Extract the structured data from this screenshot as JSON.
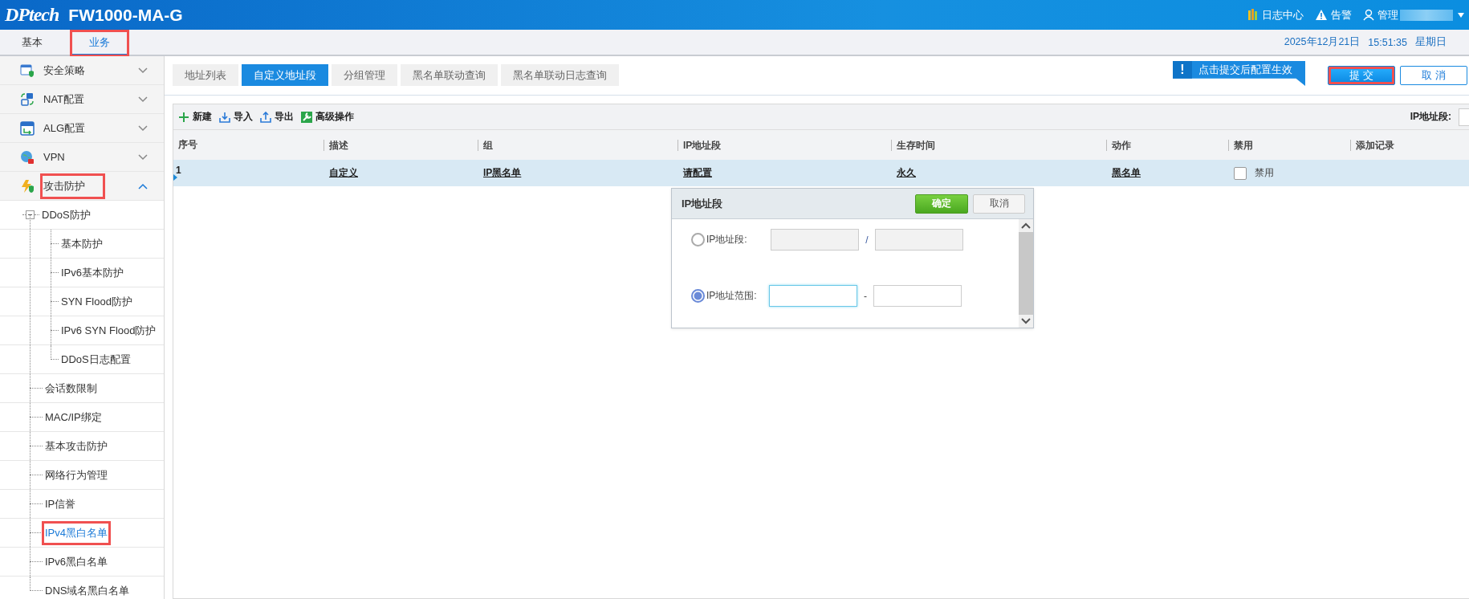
{
  "header": {
    "logo": "DPtech",
    "title": "FW1000-MA-G",
    "links": [
      {
        "label": "日志中心",
        "kind": "log"
      },
      {
        "label": "告警",
        "kind": "alarm"
      },
      {
        "label": "管理",
        "kind": "user"
      }
    ]
  },
  "nav_tabs": [
    {
      "label": "基本",
      "selected": false,
      "annotated": false
    },
    {
      "label": "业务",
      "selected": true,
      "annotated": true
    }
  ],
  "datetime": {
    "date": "2025年12月21日",
    "time": "15:51:35",
    "weekday": "星期日"
  },
  "sidebar": {
    "items": [
      {
        "label": "安全策略",
        "expanded": false,
        "selected": false,
        "annotated": false
      },
      {
        "label": "NAT配置",
        "expanded": false,
        "selected": false,
        "annotated": false
      },
      {
        "label": "ALG配置",
        "expanded": false,
        "selected": false,
        "annotated": false
      },
      {
        "label": "VPN",
        "expanded": false,
        "selected": false,
        "annotated": false
      },
      {
        "label": "攻击防护",
        "expanded": true,
        "selected": false,
        "annotated": true,
        "children": [
          {
            "label": "DDoS防护",
            "expanded": true,
            "selected": false,
            "annotated": false,
            "children": [
              {
                "label": "基本防护",
                "selected": false,
                "annotated": false
              },
              {
                "label": "IPv6基本防护",
                "selected": false,
                "annotated": false
              },
              {
                "label": "SYN Flood防护",
                "selected": false,
                "annotated": false
              },
              {
                "label": "IPv6 SYN Flood防护",
                "selected": false,
                "annotated": false
              },
              {
                "label": "DDoS日志配置",
                "selected": false,
                "annotated": false
              }
            ]
          },
          {
            "label": "会话数限制",
            "selected": false,
            "annotated": false
          },
          {
            "label": "MAC/IP绑定",
            "selected": false,
            "annotated": false
          },
          {
            "label": "基本攻击防护",
            "selected": false,
            "annotated": false
          },
          {
            "label": "网络行为管理",
            "selected": false,
            "annotated": false
          },
          {
            "label": "IP信誉",
            "selected": false,
            "annotated": false
          },
          {
            "label": "IPv4黑白名单",
            "selected": true,
            "annotated": true
          },
          {
            "label": "IPv6黑白名单",
            "selected": false,
            "annotated": false
          },
          {
            "label": "DNS域名黑白名单",
            "selected": false,
            "annotated": false
          }
        ]
      }
    ]
  },
  "tabs": [
    {
      "label": "地址列表",
      "selected": false
    },
    {
      "label": "自定义地址段",
      "selected": true
    },
    {
      "label": "分组管理",
      "selected": false
    },
    {
      "label": "黑名单联动查询",
      "selected": false
    },
    {
      "label": "黑名单联动日志查询",
      "selected": false
    }
  ],
  "notice": {
    "icon": "!",
    "text": "点击提交后配置生效"
  },
  "actions": [
    {
      "label": "提 交",
      "kind": "primary",
      "annotated": true
    },
    {
      "label": "取 消",
      "kind": "secondary",
      "annotated": false
    }
  ],
  "toolbar": [
    {
      "label": "新建",
      "kind": "add"
    },
    {
      "label": "导入",
      "kind": "import"
    },
    {
      "label": "导出",
      "kind": "export"
    },
    {
      "label": "高级操作",
      "kind": "advanced"
    }
  ],
  "filter": {
    "label": "IP地址段:"
  },
  "table": {
    "columns": [
      "序号",
      "描述",
      "组",
      "IP地址段",
      "生存时间",
      "动作",
      "禁用",
      "添加记录"
    ],
    "rows": [
      {
        "selected": true,
        "cells": [
          "1",
          "自定义",
          "IP黑名单",
          "请配置",
          "永久",
          "黑名单"
        ],
        "disable": {
          "label": "禁用",
          "checked": false
        }
      }
    ]
  },
  "dialog": {
    "title": "IP地址段",
    "confirm": "确定",
    "cancel": "取消",
    "options": [
      {
        "label": "IP地址段:",
        "selected": false,
        "separator": "/",
        "disabled": true
      },
      {
        "label": "IP地址范围:",
        "selected": true,
        "separator": "-",
        "disabled": false
      }
    ]
  }
}
